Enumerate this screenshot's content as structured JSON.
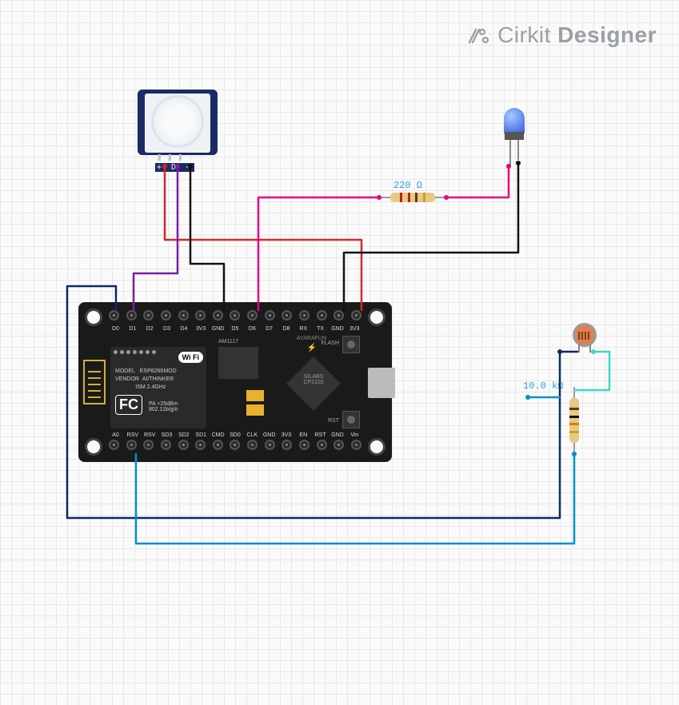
{
  "brand": {
    "name1": "Cirkit",
    "name2": "Designer"
  },
  "components": {
    "pir": {
      "name": "PIR Motion Sensor",
      "pin_labels": "+ D −"
    },
    "led": {
      "name": "LED (blue)",
      "color": "#2b52d4"
    },
    "resistor_220": {
      "label": "220 Ω",
      "value_ohms": 220
    },
    "resistor_10k": {
      "label": "10.0 kΩ",
      "value_ohms": 10000
    },
    "ldr": {
      "name": "Photoresistor (LDR)"
    },
    "esp8266": {
      "name": "NodeMCU ESP8266",
      "shield": {
        "wifi_badge": "Wi Fi",
        "model_line1": "MODEL",
        "model_line2": "VENDOR",
        "chip_line1": "ESP8266MOD",
        "chip_line2": "AI/THINKER",
        "spec_line1": "ISM 2.4GHz",
        "spec_line2": "PA +25dBm",
        "spec_line3": "802.11b/g/n",
        "fcc": "FC"
      },
      "regulator_label": "AM1117",
      "usb_chip_line1": "SILABS",
      "usb_chip_line2": "CP2102",
      "flash_label": "FLASH",
      "rst_label": "RST",
      "brand_small": "AYARAFUN",
      "pins_top": [
        "D0",
        "D1",
        "D2",
        "D3",
        "D4",
        "3V3",
        "GND",
        "D5",
        "D6",
        "D7",
        "D8",
        "RX",
        "TX",
        "GND",
        "3V3"
      ],
      "pins_bottom": [
        "A0",
        "RSV",
        "RSV",
        "SD3",
        "SD2",
        "SD1",
        "CMD",
        "SD0",
        "CLK",
        "GND",
        "3V3",
        "EN",
        "RST",
        "GND",
        "Vin"
      ]
    }
  },
  "wires": [
    {
      "name": "pir-vcc-to-3v3",
      "color": "#d62828"
    },
    {
      "name": "pir-data-to-d1",
      "color": "#7b1fa2"
    },
    {
      "name": "pir-gnd",
      "color": "#111"
    },
    {
      "name": "d6-to-220r-to-led-anode",
      "color": "#e6007e"
    },
    {
      "name": "led-cathode-to-gnd",
      "color": "#111"
    },
    {
      "name": "d0-to-ldr-top",
      "color": "#0b2a66"
    },
    {
      "name": "a0-to-node",
      "color": "#0090c8"
    },
    {
      "name": "ldr-bottom-to-10k-top",
      "color": "#3dd9c4"
    },
    {
      "name": "10k-bot-to-node",
      "color": "#0090c8"
    }
  ]
}
